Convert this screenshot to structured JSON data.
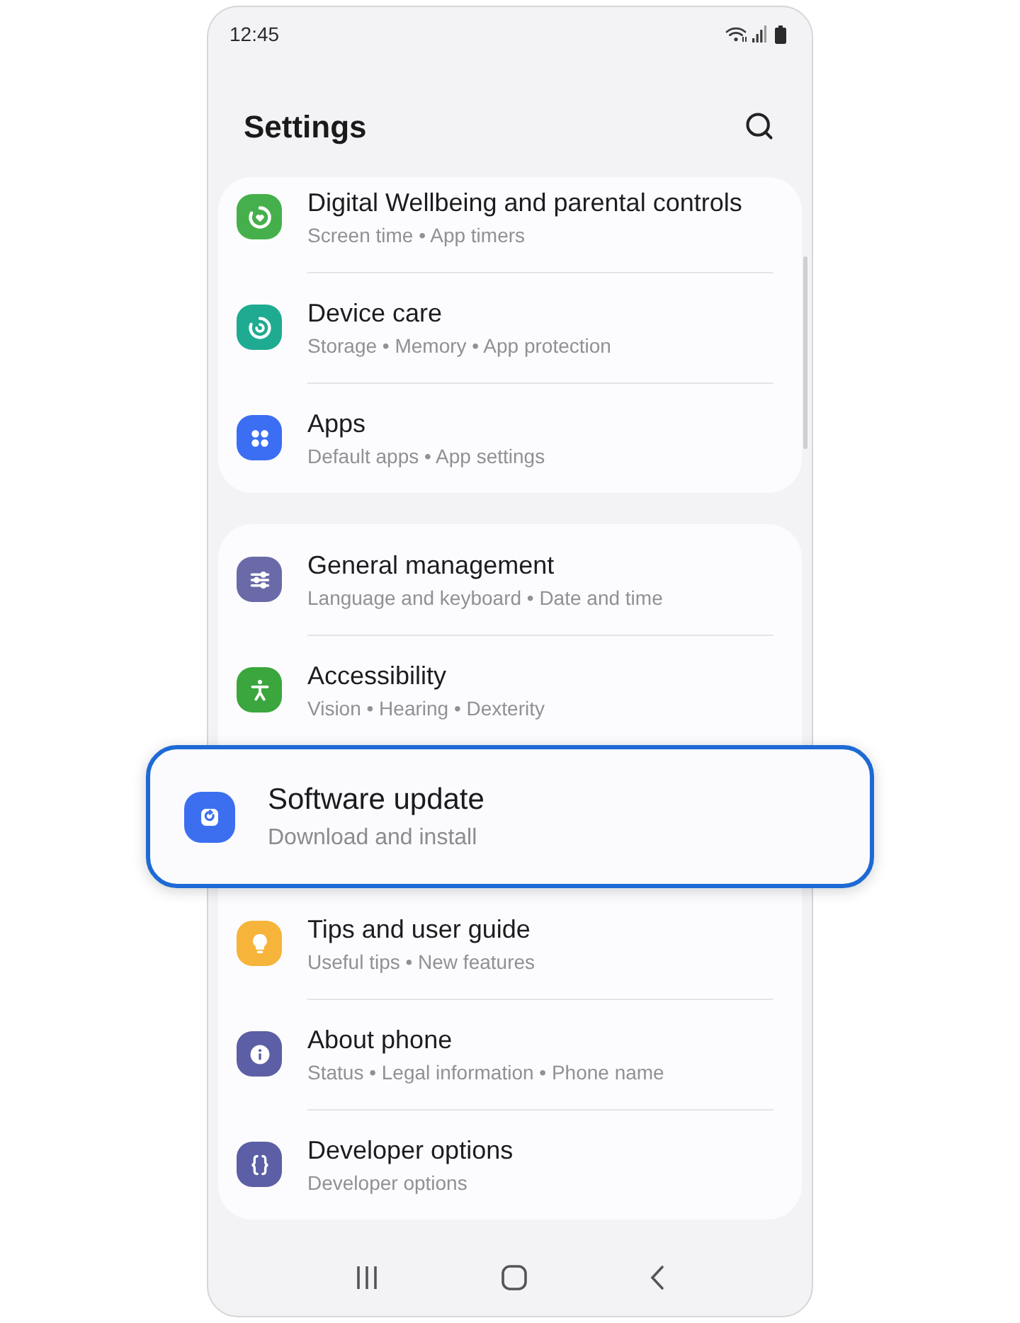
{
  "status_bar": {
    "time": "12:45"
  },
  "header": {
    "title": "Settings"
  },
  "groups": [
    {
      "items": [
        {
          "title": "Digital Wellbeing and parental controls",
          "subtitle": "Screen time • App timers",
          "color": "#45b04b",
          "highlighted": false
        },
        {
          "title": "Device care",
          "subtitle": "Storage • Memory • App protection",
          "color": "#1eab92",
          "highlighted": false
        },
        {
          "title": "Apps",
          "subtitle": "Default apps • App settings",
          "color": "#3b6ef3",
          "highlighted": false
        }
      ]
    },
    {
      "items": [
        {
          "title": "General management",
          "subtitle": "Language and keyboard • Date and time",
          "color": "#6b6aa8",
          "highlighted": false
        },
        {
          "title": "Accessibility",
          "subtitle": "Vision • Hearing • Dexterity",
          "color": "#3ba63e",
          "highlighted": false
        },
        {
          "title": "Software update",
          "subtitle": "Download and install",
          "color": "#3c6ff0",
          "highlighted": true
        },
        {
          "title": "Tips and user guide",
          "subtitle": "Useful tips • New features",
          "color": "#f6b43a",
          "highlighted": false
        },
        {
          "title": "About phone",
          "subtitle": "Status • Legal information • Phone name",
          "color": "#5c5fa5",
          "highlighted": false
        },
        {
          "title": "Developer options",
          "subtitle": "Developer options",
          "color": "#5c5fa5",
          "highlighted": false
        }
      ]
    }
  ]
}
